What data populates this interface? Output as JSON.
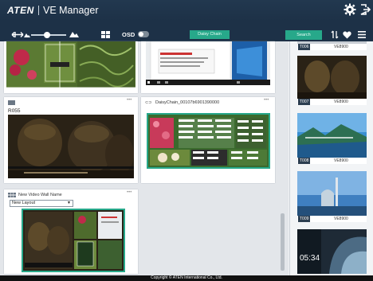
{
  "header": {
    "brand": "ATEN",
    "title": "VE Manager",
    "icons": [
      "gear-icon",
      "logout-icon"
    ]
  },
  "toolbar": {
    "osd_label": "OSD",
    "osd_on": false,
    "zoom_level": 0.45,
    "daisy_chain_label": "Daisy Chain",
    "search_label": "Search",
    "icons": [
      "resize-icon",
      "small-mountain-icon",
      "large-mountain-icon",
      "grid-icon",
      "sort-icon",
      "heart-icon",
      "menu-icon"
    ]
  },
  "panels": {
    "r055_label": "R055",
    "daisy_chain_name": "DaisyChain_00107b6901390000",
    "video_wall_name": "New Video Wall Name",
    "layout_select": "New Layout"
  },
  "sidebar": {
    "devices": [
      {
        "id": "T006",
        "model": "VE8900"
      },
      {
        "id": "T007",
        "model": "VE8900"
      },
      {
        "id": "T008",
        "model": "VE8900"
      },
      {
        "id": "T009",
        "model": "VE8900"
      }
    ],
    "clock": "05:34"
  },
  "footer": {
    "copyright": "Copyright © ATEN International Co., Ltd."
  },
  "colors": {
    "header_bg": "#1d3147",
    "accent_green": "#27a88a",
    "content_bg": "#e3e6ea"
  }
}
